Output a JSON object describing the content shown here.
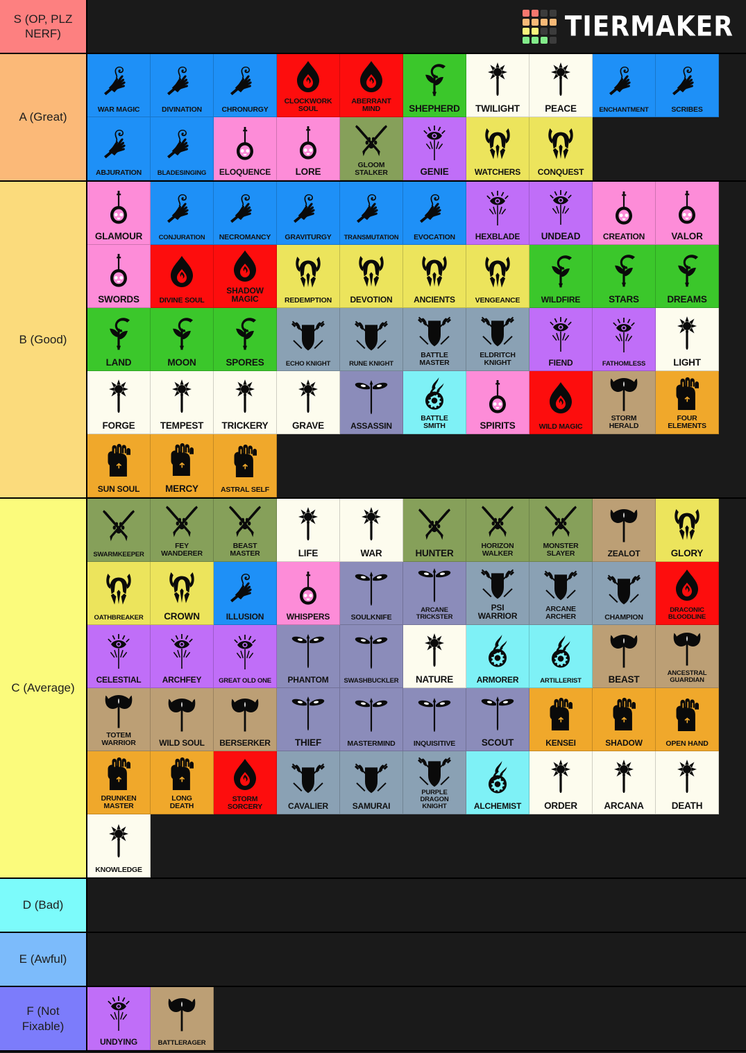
{
  "app": {
    "logo_text": "TIERMAKER",
    "logo_colors": [
      "#f8776e",
      "#f8776e",
      "#3c3c3c",
      "#3c3c3c",
      "#f8b977",
      "#f8b977",
      "#f8b977",
      "#f8b977",
      "#f9f47d",
      "#f9f47d",
      "#3c3c3c",
      "#3c3c3c",
      "#82eb8a",
      "#82eb8a",
      "#82eb8a",
      "#3c3c3c"
    ]
  },
  "palette": {
    "wizard_blue": "#1e90f7",
    "sorcerer_red": "#fd0d0d",
    "bard_pink": "#fd8cd8",
    "druid_green": "#3bc72b",
    "cleric_cream": "#fdfcee",
    "paladin_yellow": "#ede martial",
    "paladin": "#ece45c",
    "warlock_purple": "#c06ef8",
    "ranger_olive": "#86a05a",
    "fighter_steel": "#8aa1b4",
    "rogue_slate": "#8b8cba",
    "artificer_cyan": "#7ef1f6",
    "barbarian_tan": "#bc9f75",
    "monk_orange": "#f0a82b",
    "tier_s": "#fd8080",
    "tier_a": "#fbb978",
    "tier_b": "#fbdb7c",
    "tier_c": "#fbfb7c",
    "tier_d": "#7cfbfb",
    "tier_e": "#7cbbfb",
    "tier_f": "#7c7cfb",
    "background": "#1a1a1a"
  },
  "tiers": [
    {
      "label": "S (OP, PLZ NERF)",
      "color": "#fd8080",
      "items": []
    },
    {
      "label": "A (Great)",
      "color": "#fbb978",
      "items": [
        {
          "name": "WAR MAGIC",
          "bg": "#1e90f7",
          "icon": "wizard-hand-icon",
          "size": "s3"
        },
        {
          "name": "DIVINATION",
          "bg": "#1e90f7",
          "icon": "wizard-hand-icon",
          "size": "s3"
        },
        {
          "name": "CHRONURGY",
          "bg": "#1e90f7",
          "icon": "wizard-hand-icon",
          "size": "s3"
        },
        {
          "name": "CLOCKWORK SOUL",
          "bg": "#fd0d0d",
          "icon": "sorcerer-flame-icon",
          "size": "s3"
        },
        {
          "name": "ABERRANT MIND",
          "bg": "#fd0d0d",
          "icon": "sorcerer-flame-icon",
          "size": "s3"
        },
        {
          "name": "SHEPHERD",
          "bg": "#3bc72b",
          "icon": "druid-leaf-icon",
          "size": "s1"
        },
        {
          "name": "TWILIGHT",
          "bg": "#fdfcee",
          "icon": "cleric-mace-icon",
          "size": "s1"
        },
        {
          "name": "PEACE",
          "bg": "#fdfcee",
          "icon": "cleric-mace-icon",
          "size": "s1"
        },
        {
          "name": "ENCHANTMENT",
          "bg": "#1e90f7",
          "icon": "wizard-hand-icon",
          "size": "s4"
        },
        {
          "name": "SCRIBES",
          "bg": "#1e90f7",
          "icon": "wizard-hand-icon",
          "size": "s3"
        },
        {
          "name": "ABJURATION",
          "bg": "#1e90f7",
          "icon": "wizard-hand-icon",
          "size": "s3"
        },
        {
          "name": "BLADESINGING",
          "bg": "#1e90f7",
          "icon": "wizard-hand-icon",
          "size": "s4"
        },
        {
          "name": "ELOQUENCE",
          "bg": "#fd8cd8",
          "icon": "bard-lute-icon",
          "size": "s2"
        },
        {
          "name": "LORE",
          "bg": "#fd8cd8",
          "icon": "bard-lute-icon",
          "size": "s1"
        },
        {
          "name": "GLOOM STALKER",
          "bg": "#86a05a",
          "icon": "ranger-arrows-icon",
          "size": "s3"
        },
        {
          "name": "GENIE",
          "bg": "#c06ef8",
          "icon": "warlock-eye-icon",
          "size": "s1"
        },
        {
          "name": "WATCHERS",
          "bg": "#ece45c",
          "icon": "paladin-helm-icon",
          "size": "s2"
        },
        {
          "name": "CONQUEST",
          "bg": "#ece45c",
          "icon": "paladin-helm-icon",
          "size": "s2"
        }
      ]
    },
    {
      "label": "B (Good)",
      "color": "#fbdb7c",
      "items": [
        {
          "name": "GLAMOUR",
          "bg": "#fd8cd8",
          "icon": "bard-lute-icon",
          "size": "s1"
        },
        {
          "name": "CONJURATION",
          "bg": "#1e90f7",
          "icon": "wizard-hand-icon",
          "size": "s4"
        },
        {
          "name": "NECROMANCY",
          "bg": "#1e90f7",
          "icon": "wizard-hand-icon",
          "size": "s3"
        },
        {
          "name": "GRAVITURGY",
          "bg": "#1e90f7",
          "icon": "wizard-hand-icon",
          "size": "s3"
        },
        {
          "name": "TRANSMUTATION",
          "bg": "#1e90f7",
          "icon": "wizard-hand-icon",
          "size": "s4"
        },
        {
          "name": "EVOCATION",
          "bg": "#1e90f7",
          "icon": "wizard-hand-icon",
          "size": "s3"
        },
        {
          "name": "HEXBLADE",
          "bg": "#c06ef8",
          "icon": "warlock-eye-icon",
          "size": "s2"
        },
        {
          "name": "UNDEAD",
          "bg": "#c06ef8",
          "icon": "warlock-eye-icon",
          "size": "s1"
        },
        {
          "name": "CREATION",
          "bg": "#fd8cd8",
          "icon": "bard-lute-icon",
          "size": "s2"
        },
        {
          "name": "VALOR",
          "bg": "#fd8cd8",
          "icon": "bard-lute-icon",
          "size": "s1"
        },
        {
          "name": "SWORDS",
          "bg": "#fd8cd8",
          "icon": "bard-lute-icon",
          "size": "s1"
        },
        {
          "name": "DIVINE SOUL",
          "bg": "#fd0d0d",
          "icon": "sorcerer-flame-icon",
          "size": "s3"
        },
        {
          "name": "SHADOW MAGIC",
          "bg": "#fd0d0d",
          "icon": "sorcerer-flame-icon",
          "size": "s2"
        },
        {
          "name": "REDEMPTION",
          "bg": "#ece45c",
          "icon": "paladin-helm-icon",
          "size": "s3"
        },
        {
          "name": "DEVOTION",
          "bg": "#ece45c",
          "icon": "paladin-helm-icon",
          "size": "s2"
        },
        {
          "name": "ANCIENTS",
          "bg": "#ece45c",
          "icon": "paladin-helm-icon",
          "size": "s2"
        },
        {
          "name": "VENGEANCE",
          "bg": "#ece45c",
          "icon": "paladin-helm-icon",
          "size": "s3"
        },
        {
          "name": "WILDFIRE",
          "bg": "#3bc72b",
          "icon": "druid-leaf-icon",
          "size": "s2"
        },
        {
          "name": "STARS",
          "bg": "#3bc72b",
          "icon": "druid-leaf-icon",
          "size": "s1"
        },
        {
          "name": "DREAMS",
          "bg": "#3bc72b",
          "icon": "druid-leaf-icon",
          "size": "s1"
        },
        {
          "name": "LAND",
          "bg": "#3bc72b",
          "icon": "druid-leaf-icon",
          "size": "s1"
        },
        {
          "name": "MOON",
          "bg": "#3bc72b",
          "icon": "druid-leaf-icon",
          "size": "s1"
        },
        {
          "name": "SPORES",
          "bg": "#3bc72b",
          "icon": "druid-leaf-icon",
          "size": "s1"
        },
        {
          "name": "ECHO KNIGHT",
          "bg": "#8aa1b4",
          "icon": "fighter-shield-icon",
          "size": "s4"
        },
        {
          "name": "RUNE KNIGHT",
          "bg": "#8aa1b4",
          "icon": "fighter-shield-icon",
          "size": "s4"
        },
        {
          "name": "BATTLE MASTER",
          "bg": "#8aa1b4",
          "icon": "fighter-shield-icon",
          "size": "s3"
        },
        {
          "name": "ELDRITCH KNIGHT",
          "bg": "#8aa1b4",
          "icon": "fighter-shield-icon",
          "size": "s3"
        },
        {
          "name": "FIEND",
          "bg": "#c06ef8",
          "icon": "warlock-eye-icon",
          "size": "s2"
        },
        {
          "name": "FATHOMLESS",
          "bg": "#c06ef8",
          "icon": "warlock-eye-icon",
          "size": "s4"
        },
        {
          "name": "LIGHT",
          "bg": "#fdfcee",
          "icon": "cleric-mace-icon",
          "size": "s1"
        },
        {
          "name": "FORGE",
          "bg": "#fdfcee",
          "icon": "cleric-mace-icon",
          "size": "s1"
        },
        {
          "name": "TEMPEST",
          "bg": "#fdfcee",
          "icon": "cleric-mace-icon",
          "size": "s1"
        },
        {
          "name": "TRICKERY",
          "bg": "#fdfcee",
          "icon": "cleric-mace-icon",
          "size": "s1"
        },
        {
          "name": "GRAVE",
          "bg": "#fdfcee",
          "icon": "cleric-mace-icon",
          "size": "s1"
        },
        {
          "name": "ASSASSIN",
          "bg": "#8b8cba",
          "icon": "rogue-dagger-icon",
          "size": "s2"
        },
        {
          "name": "BATTLE SMITH",
          "bg": "#7ef1f6",
          "icon": "artificer-gear-icon",
          "size": "s3"
        },
        {
          "name": "SPIRITS",
          "bg": "#fd8cd8",
          "icon": "bard-lute-icon",
          "size": "s1"
        },
        {
          "name": "WILD MAGIC",
          "bg": "#fd0d0d",
          "icon": "sorcerer-flame-icon",
          "size": "s3"
        },
        {
          "name": "STORM HERALD",
          "bg": "#bc9f75",
          "icon": "barbarian-axe-icon",
          "size": "s3"
        },
        {
          "name": "FOUR ELEMENTS",
          "bg": "#f0a82b",
          "icon": "monk-fist-icon",
          "size": "s3"
        },
        {
          "name": "SUN SOUL",
          "bg": "#f0a82b",
          "icon": "monk-fist-icon",
          "size": "s2"
        },
        {
          "name": "MERCY",
          "bg": "#f0a82b",
          "icon": "monk-fist-icon",
          "size": "s1"
        },
        {
          "name": "ASTRAL SELF",
          "bg": "#f0a82b",
          "icon": "monk-fist-icon",
          "size": "s3"
        }
      ]
    },
    {
      "label": "C (Average)",
      "color": "#fbfb7c",
      "items": [
        {
          "name": "SWARMKEEPER",
          "bg": "#86a05a",
          "icon": "ranger-arrows-icon",
          "size": "s4"
        },
        {
          "name": "FEY WANDERER",
          "bg": "#86a05a",
          "icon": "ranger-arrows-icon",
          "size": "s3"
        },
        {
          "name": "BEAST MASTER",
          "bg": "#86a05a",
          "icon": "ranger-arrows-icon",
          "size": "s3"
        },
        {
          "name": "LIFE",
          "bg": "#fdfcee",
          "icon": "cleric-mace-icon",
          "size": "s1"
        },
        {
          "name": "WAR",
          "bg": "#fdfcee",
          "icon": "cleric-mace-icon",
          "size": "s1"
        },
        {
          "name": "HUNTER",
          "bg": "#86a05a",
          "icon": "ranger-arrows-icon",
          "size": "s1"
        },
        {
          "name": "HORIZON WALKER",
          "bg": "#86a05a",
          "icon": "ranger-arrows-icon",
          "size": "s3"
        },
        {
          "name": "MONSTER SLAYER",
          "bg": "#86a05a",
          "icon": "ranger-arrows-icon",
          "size": "s3"
        },
        {
          "name": "ZEALOT",
          "bg": "#bc9f75",
          "icon": "barbarian-axe-icon",
          "size": "s2"
        },
        {
          "name": "GLORY",
          "bg": "#ece45c",
          "icon": "paladin-helm-icon",
          "size": "s1"
        },
        {
          "name": "OATHBREAKER",
          "bg": "#ece45c",
          "icon": "paladin-helm-icon",
          "size": "s4"
        },
        {
          "name": "CROWN",
          "bg": "#ece45c",
          "icon": "paladin-helm-icon",
          "size": "s1"
        },
        {
          "name": "ILLUSION",
          "bg": "#1e90f7",
          "icon": "wizard-hand-icon",
          "size": "s2"
        },
        {
          "name": "WHISPERS",
          "bg": "#fd8cd8",
          "icon": "bard-lute-icon",
          "size": "s2"
        },
        {
          "name": "SOULKNIFE",
          "bg": "#8b8cba",
          "icon": "rogue-dagger-icon",
          "size": "s3"
        },
        {
          "name": "ARCANE TRICKSTER",
          "bg": "#8b8cba",
          "icon": "rogue-dagger-icon",
          "size": "s4"
        },
        {
          "name": "PSI WARRIOR",
          "bg": "#8aa1b4",
          "icon": "fighter-shield-icon",
          "size": "s2"
        },
        {
          "name": "ARCANE ARCHER",
          "bg": "#8aa1b4",
          "icon": "fighter-shield-icon",
          "size": "s3"
        },
        {
          "name": "CHAMPION",
          "bg": "#8aa1b4",
          "icon": "fighter-shield-icon",
          "size": "s3"
        },
        {
          "name": "DRACONIC BLOODLINE",
          "bg": "#fd0d0d",
          "icon": "sorcerer-flame-icon",
          "size": "s4"
        },
        {
          "name": "CELESTIAL",
          "bg": "#c06ef8",
          "icon": "warlock-eye-icon",
          "size": "s2"
        },
        {
          "name": "ARCHFEY",
          "bg": "#c06ef8",
          "icon": "warlock-eye-icon",
          "size": "s2"
        },
        {
          "name": "GREAT OLD ONE",
          "bg": "#c06ef8",
          "icon": "warlock-eye-icon",
          "size": "s4"
        },
        {
          "name": "PHANTOM",
          "bg": "#8b8cba",
          "icon": "rogue-dagger-icon",
          "size": "s2"
        },
        {
          "name": "SWASHBUCKLER",
          "bg": "#8b8cba",
          "icon": "rogue-dagger-icon",
          "size": "s4"
        },
        {
          "name": "NATURE",
          "bg": "#fdfcee",
          "icon": "cleric-mace-icon",
          "size": "s1"
        },
        {
          "name": "ARMORER",
          "bg": "#7ef1f6",
          "icon": "artificer-gear-icon",
          "size": "s2"
        },
        {
          "name": "ARTILLERIST",
          "bg": "#7ef1f6",
          "icon": "artificer-gear-icon",
          "size": "s4"
        },
        {
          "name": "BEAST",
          "bg": "#bc9f75",
          "icon": "barbarian-axe-icon",
          "size": "s1"
        },
        {
          "name": "ANCESTRAL GUARDIAN",
          "bg": "#bc9f75",
          "icon": "barbarian-axe-icon",
          "size": "s4"
        },
        {
          "name": "TOTEM WARRIOR",
          "bg": "#bc9f75",
          "icon": "barbarian-axe-icon",
          "size": "s3"
        },
        {
          "name": "WILD SOUL",
          "bg": "#bc9f75",
          "icon": "barbarian-axe-icon",
          "size": "s2"
        },
        {
          "name": "BERSERKER",
          "bg": "#bc9f75",
          "icon": "barbarian-axe-icon",
          "size": "s2"
        },
        {
          "name": "THIEF",
          "bg": "#8b8cba",
          "icon": "rogue-dagger-icon",
          "size": "s1"
        },
        {
          "name": "MASTERMIND",
          "bg": "#8b8cba",
          "icon": "rogue-dagger-icon",
          "size": "s3"
        },
        {
          "name": "INQUISITIVE",
          "bg": "#8b8cba",
          "icon": "rogue-dagger-icon",
          "size": "s3"
        },
        {
          "name": "SCOUT",
          "bg": "#8b8cba",
          "icon": "rogue-dagger-icon",
          "size": "s1"
        },
        {
          "name": "KENSEI",
          "bg": "#f0a82b",
          "icon": "monk-fist-icon",
          "size": "s2"
        },
        {
          "name": "SHADOW",
          "bg": "#f0a82b",
          "icon": "monk-fist-icon",
          "size": "s2"
        },
        {
          "name": "OPEN HAND",
          "bg": "#f0a82b",
          "icon": "monk-fist-icon",
          "size": "s3"
        },
        {
          "name": "DRUNKEN MASTER",
          "bg": "#f0a82b",
          "icon": "monk-fist-icon",
          "size": "s3"
        },
        {
          "name": "LONG DEATH",
          "bg": "#f0a82b",
          "icon": "monk-fist-icon",
          "size": "s3"
        },
        {
          "name": "STORM SORCERY",
          "bg": "#fd0d0d",
          "icon": "sorcerer-flame-icon",
          "size": "s3"
        },
        {
          "name": "CAVALIER",
          "bg": "#8aa1b4",
          "icon": "fighter-shield-icon",
          "size": "s2"
        },
        {
          "name": "SAMURAI",
          "bg": "#8aa1b4",
          "icon": "fighter-shield-icon",
          "size": "s2"
        },
        {
          "name": "PURPLE DRAGON KNIGHT",
          "bg": "#8aa1b4",
          "icon": "fighter-shield-icon",
          "size": "s4"
        },
        {
          "name": "ALCHEMIST",
          "bg": "#7ef1f6",
          "icon": "artificer-gear-icon",
          "size": "s2"
        },
        {
          "name": "ORDER",
          "bg": "#fdfcee",
          "icon": "cleric-mace-icon",
          "size": "s1"
        },
        {
          "name": "ARCANA",
          "bg": "#fdfcee",
          "icon": "cleric-mace-icon",
          "size": "s1"
        },
        {
          "name": "DEATH",
          "bg": "#fdfcee",
          "icon": "cleric-mace-icon",
          "size": "s1"
        },
        {
          "name": "KNOWLEDGE",
          "bg": "#fdfcee",
          "icon": "cleric-mace-icon",
          "size": "s3"
        }
      ]
    },
    {
      "label": "D (Bad)",
      "color": "#7cfbfb",
      "items": []
    },
    {
      "label": "E (Awful)",
      "color": "#7cbbfb",
      "items": []
    },
    {
      "label": "F (Not Fixable)",
      "color": "#7c7cfb",
      "items": [
        {
          "name": "UNDYING",
          "bg": "#c06ef8",
          "icon": "warlock-eye-icon",
          "size": "s2"
        },
        {
          "name": "BATTLERAGER",
          "bg": "#bc9f75",
          "icon": "barbarian-axe-icon",
          "size": "s4"
        }
      ]
    }
  ]
}
